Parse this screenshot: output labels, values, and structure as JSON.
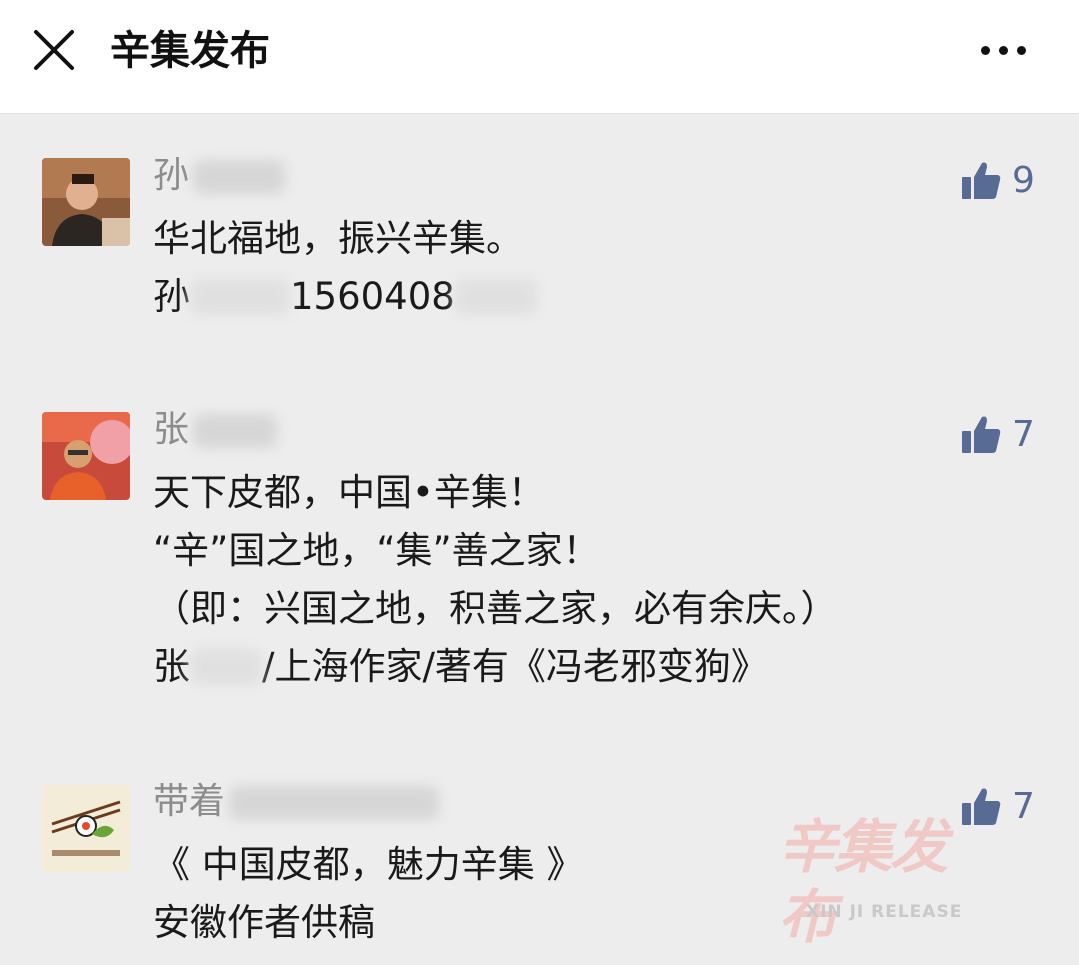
{
  "header": {
    "title": "辛集发布",
    "close_icon": "close-icon",
    "more_icon": "more-dots-icon"
  },
  "comments": [
    {
      "author_visible": "孙",
      "likes": "9",
      "lines": [
        "华北福地，振兴辛集。"
      ],
      "signature_prefix": "孙",
      "signature_visible": "1560408"
    },
    {
      "author_visible": "张",
      "likes": "7",
      "lines": [
        "天下皮都，中国•辛集！",
        "“辛”国之地，“集”善之家！",
        "（即：兴国之地，积善之家，必有余庆。）"
      ],
      "signature_prefix": "张",
      "signature_visible": "/上海作家/著有《冯老邪变狗》"
    },
    {
      "author_visible": "带着",
      "likes": "7",
      "lines": [
        "《 中国皮都，魅力辛集 》",
        "安徽作者供稿"
      ]
    }
  ],
  "watermark": {
    "title": "辛集发布",
    "subtitle": "XIN JI RELEASE"
  },
  "colors": {
    "like_blue": "#576b95",
    "author_gray": "#8c8c8c",
    "background": "#ededed"
  }
}
